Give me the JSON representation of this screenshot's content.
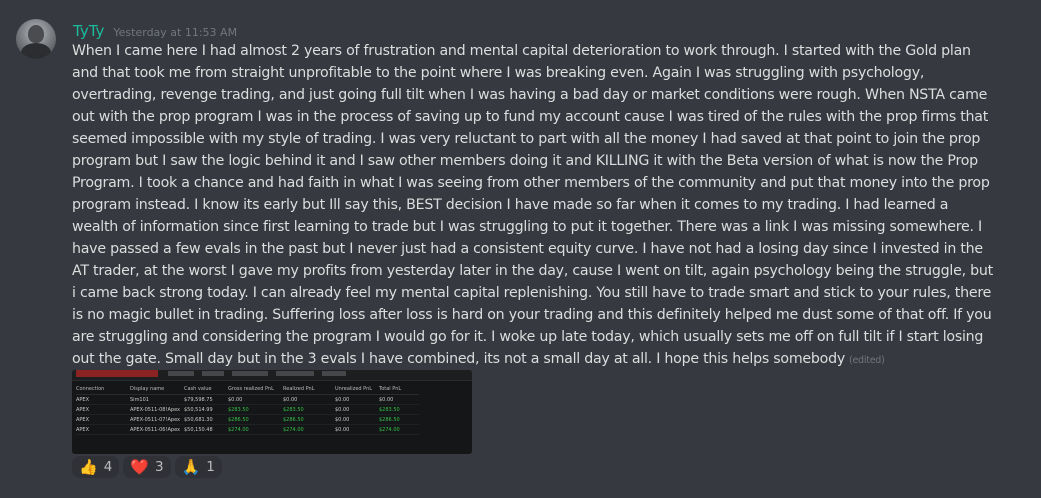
{
  "author": {
    "username": "TyTy",
    "timestamp": "Yesterday at 11:53 AM"
  },
  "message": {
    "text": "When I came here I had almost 2 years of frustration and mental capital deterioration to work through. I started with the Gold plan and that took me from straight unprofitable to the point where I was breaking even. Again I was struggling with psychology, overtrading, revenge trading, and just going full tilt when I was having a bad day or market conditions were rough. When NSTA came out with the prop program I was in the process of saving up to fund my account cause  I was tired of the rules with the prop firms that seemed impossible with my style of trading. I was very reluctant to part with all the money I had saved at that point to join the prop program but I saw the logic behind it and I saw other members doing it and KILLING it with the Beta version of what is now the Prop Program. I took a chance and had faith in what I was seeing from other members of the community and put that money into the prop program instead. I know its early but Ill say this, BEST decision I have made so far when it comes to my trading. I had learned a wealth of information since first learning to trade but I was struggling to put it together. There was a link I was missing somewhere. I have passed a few evals in the past but I never just had a consistent equity curve. I have not had a losing day since I invested in the AT trader, at the worst I gave my profits from yesterday  later in the day, cause I went on tilt, again psychology being the struggle, but i came back strong today.  I can already feel my mental capital replenishing. You still have to trade smart and stick to your rules, there is no magic bullet in trading. Suffering loss after loss is hard on your trading and this definitely helped me dust some of that off. If you are struggling and considering the program I would go for it. I woke up late today, which usually sets me off on full tilt if I start losing out the gate. Small day but in the 3 evals I have combined, its not a small day at all. I hope this helps somebody",
    "edited_label": "(edited)"
  },
  "attachment": {
    "columns": [
      "Connection",
      "Display name",
      "Cash value",
      "Gross realized PnL",
      "Realized PnL",
      "Unrealized PnL",
      "Total PnL"
    ],
    "rows": [
      [
        "APEX",
        "Sim101",
        "$79,598.75",
        "$0.00",
        "$0.00",
        "$0.00",
        "$0.00"
      ],
      [
        "APEX",
        "APEX-0511-08!Apex",
        "$50,514.99",
        "$283.50",
        "$283.50",
        "$0.00",
        "$283.50"
      ],
      [
        "APEX",
        "APEX-0511-07!Apex",
        "$50,681.30",
        "$286.50",
        "$286.50",
        "$0.00",
        "$286.50"
      ],
      [
        "APEX",
        "APEX-0511-06!Apex",
        "$50,150.48",
        "$274.00",
        "$274.00",
        "$0.00",
        "$274.00"
      ]
    ],
    "positive_color": "#33c14a"
  },
  "reactions": [
    {
      "emoji": "👍",
      "icon": "thumbs-up-icon",
      "count": "4"
    },
    {
      "emoji": "❤️",
      "icon": "heart-icon",
      "count": "3"
    },
    {
      "emoji": "🙏",
      "icon": "praying-hands-icon",
      "count": "1"
    }
  ],
  "colors": {
    "background": "#36393f",
    "username": "#1abc9c",
    "text": "#dcddde",
    "muted": "#72767d"
  }
}
